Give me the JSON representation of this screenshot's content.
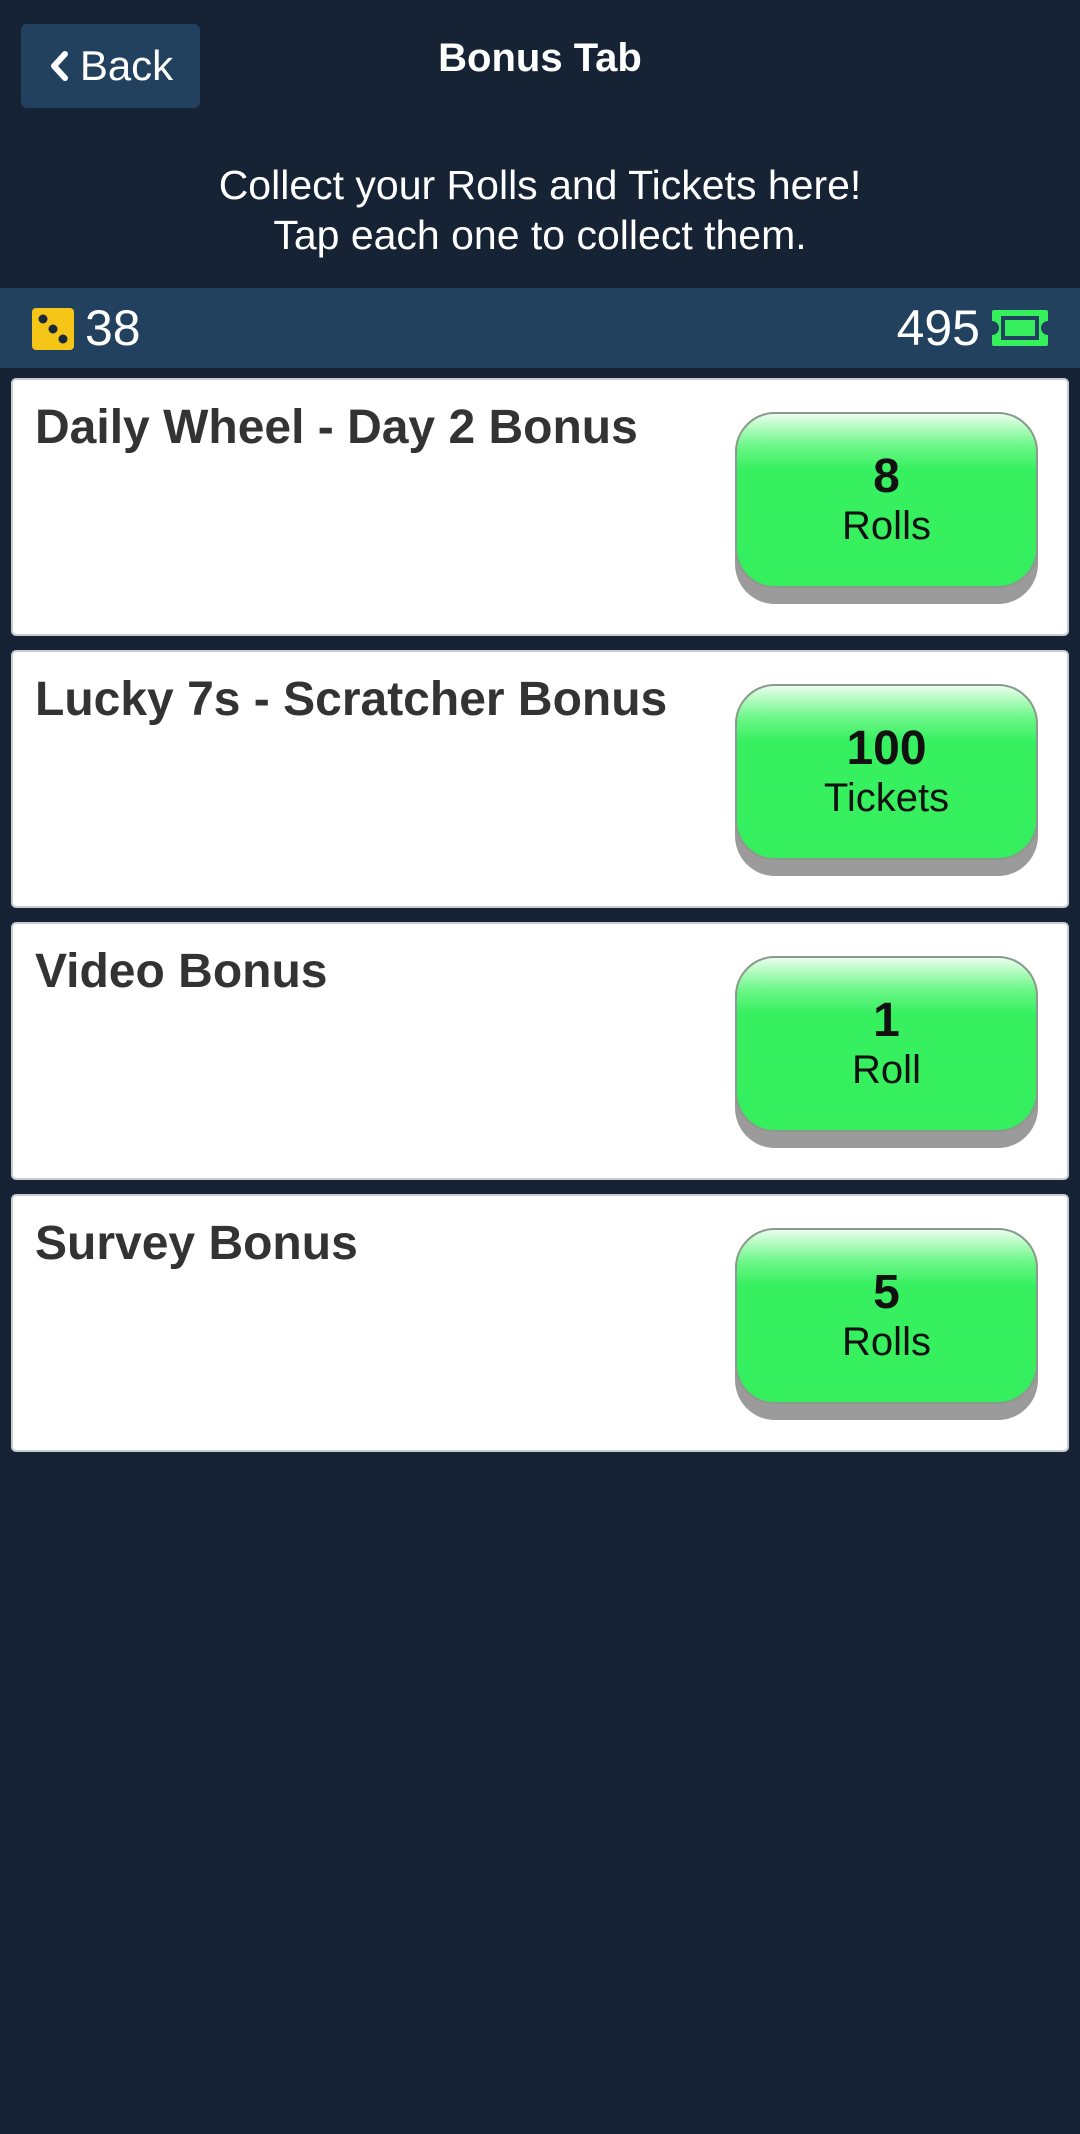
{
  "header": {
    "back_label": "Back",
    "title": "Bonus Tab"
  },
  "subtitle": {
    "line1": "Collect your Rolls and Tickets here!",
    "line2": "Tap each one to collect them."
  },
  "currency": {
    "rolls": "38",
    "tickets": "495",
    "dice_icon": "dice-icon",
    "ticket_icon": "ticket-icon",
    "dice_color": "#f5c518",
    "ticket_color": "#35ef5d"
  },
  "bonuses": [
    {
      "title": "Daily Wheel - Day 2 Bonus",
      "amount": "8",
      "unit": "Rolls"
    },
    {
      "title": "Lucky 7s - Scratcher Bonus",
      "amount": "100",
      "unit": "Tickets"
    },
    {
      "title": "Video Bonus",
      "amount": "1",
      "unit": "Roll"
    },
    {
      "title": "Survey Bonus",
      "amount": "5",
      "unit": "Rolls"
    }
  ],
  "colors": {
    "background": "#152335",
    "bar": "#21415e",
    "button_green": "#35ef5d"
  }
}
